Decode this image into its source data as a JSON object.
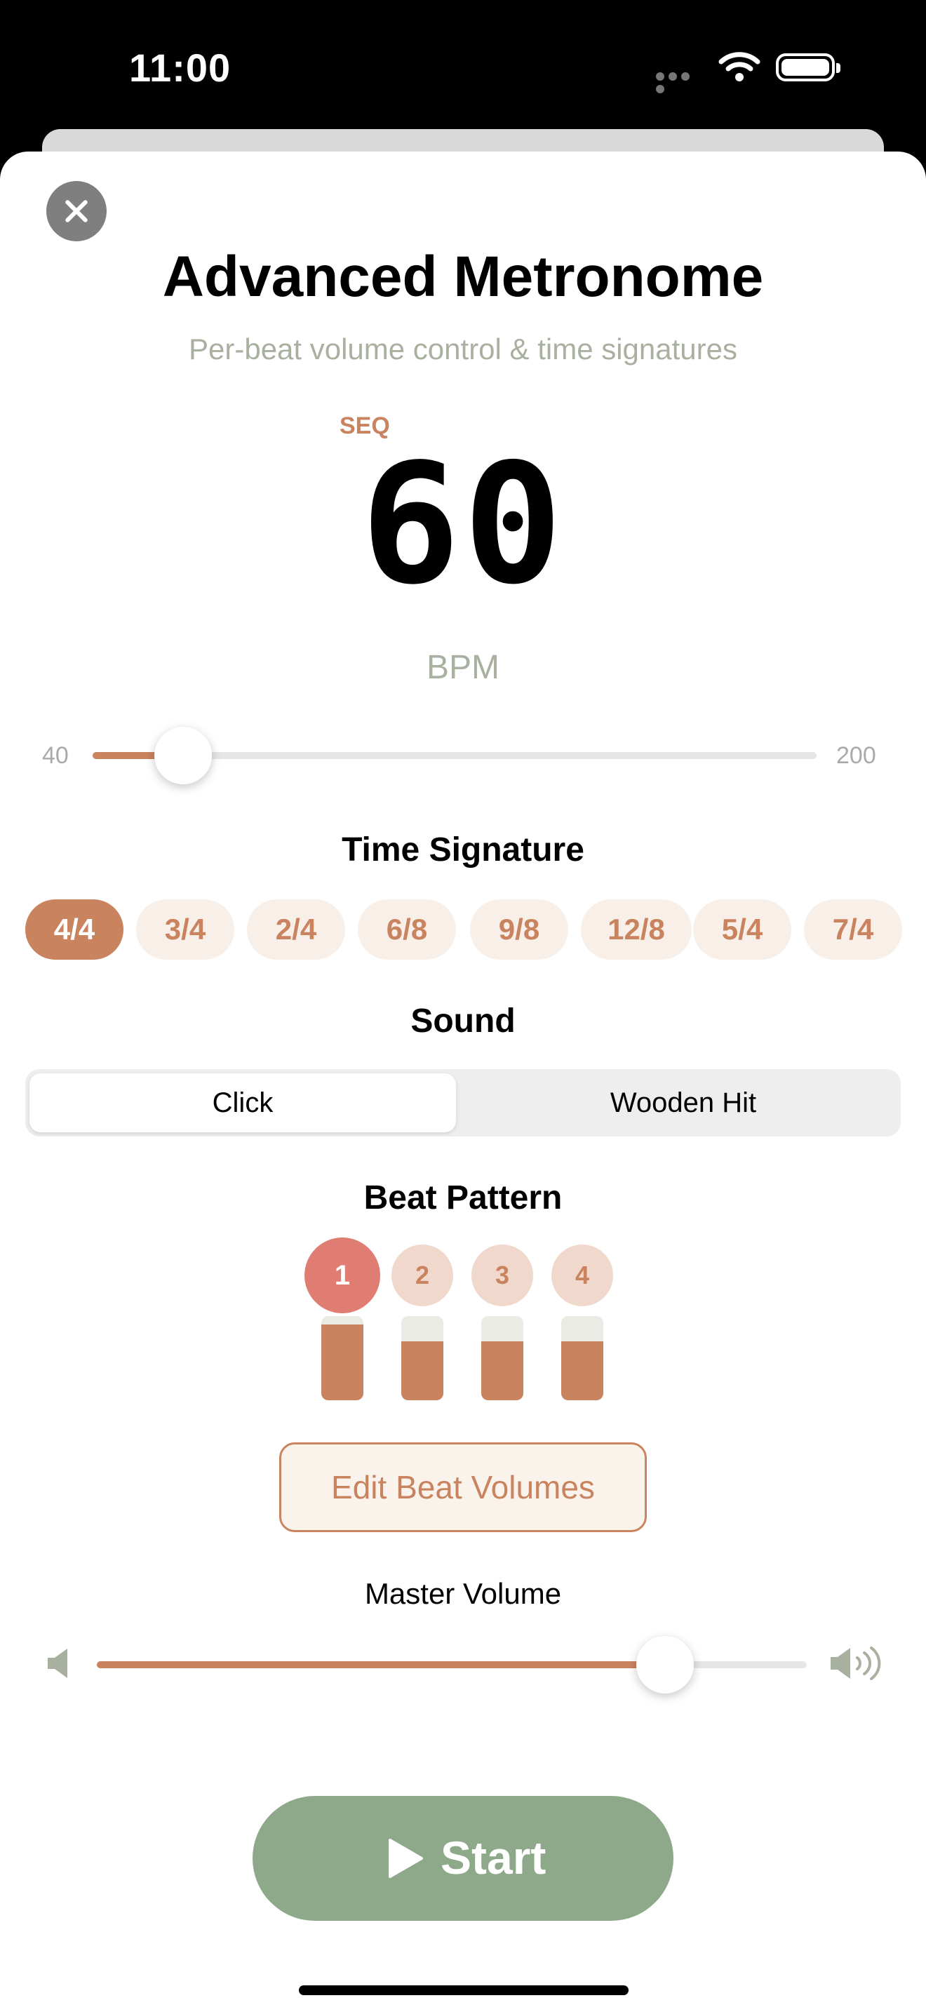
{
  "status_bar": {
    "time": "11:00"
  },
  "header": {
    "title": "Advanced Metronome",
    "subtitle": "Per-beat volume control & time signatures"
  },
  "tempo": {
    "mode_badge": "SEQ",
    "bpm": "60",
    "unit": "BPM",
    "min_label": "40",
    "max_label": "200",
    "slider_fraction": 0.125
  },
  "time_signature": {
    "title": "Time Signature",
    "options": [
      "4/4",
      "3/4",
      "2/4",
      "6/8",
      "9/8",
      "12/8",
      "5/4",
      "7/4"
    ],
    "selected": "4/4"
  },
  "sound": {
    "title": "Sound",
    "options": [
      "Click",
      "Wooden Hit"
    ],
    "selected": "Click"
  },
  "beat_pattern": {
    "title": "Beat Pattern",
    "beats": [
      {
        "number": "1",
        "active": true,
        "volume": 0.9
      },
      {
        "number": "2",
        "active": false,
        "volume": 0.7
      },
      {
        "number": "3",
        "active": false,
        "volume": 0.7
      },
      {
        "number": "4",
        "active": false,
        "volume": 0.7
      }
    ],
    "edit_label": "Edit Beat Volumes"
  },
  "master_volume": {
    "label": "Master Volume",
    "fraction": 0.8
  },
  "start_button": {
    "label": "Start"
  },
  "colors": {
    "accent": "#c9835f",
    "chip_bg": "#f7efe8",
    "start_green": "#8ea98a",
    "active_beat": "#e07d73",
    "beat_idle": "#f0d9cc"
  }
}
